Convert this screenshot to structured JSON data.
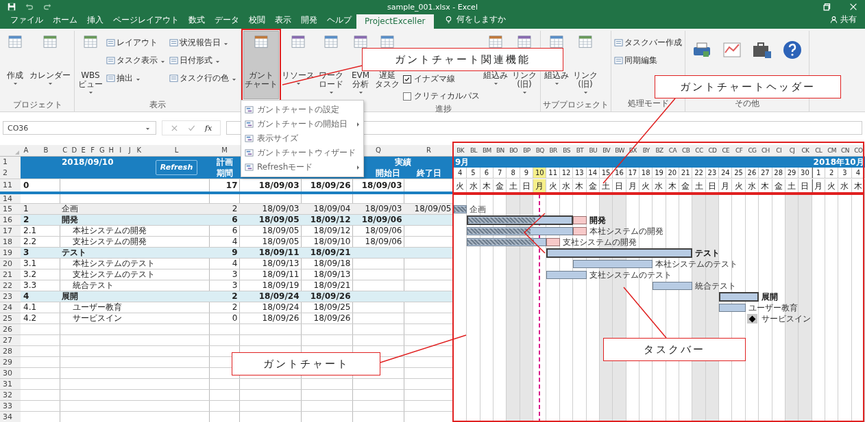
{
  "window": {
    "title": "sample_001.xlsx - Excel"
  },
  "ribbon_tabs": [
    {
      "label": "ファイル",
      "selected": false
    },
    {
      "label": "ホーム",
      "selected": false
    },
    {
      "label": "挿入",
      "selected": false
    },
    {
      "label": "ページレイアウト",
      "selected": false
    },
    {
      "label": "数式",
      "selected": false
    },
    {
      "label": "データ",
      "selected": false
    },
    {
      "label": "校閲",
      "selected": false
    },
    {
      "label": "表示",
      "selected": false
    },
    {
      "label": "開発",
      "selected": false
    },
    {
      "label": "ヘルプ",
      "selected": false
    },
    {
      "label": "ProjectExceller",
      "selected": true
    }
  ],
  "tell_me": "何をしますか",
  "share": "共有",
  "ribbon_groups": [
    {
      "label": "プロジェクト",
      "items": [
        {
          "kind": "large",
          "lines": [
            "作成"
          ],
          "dropdown": true,
          "pressed": false
        },
        {
          "kind": "large",
          "lines": [
            "カレンダー"
          ],
          "dropdown": true,
          "pressed": false
        }
      ]
    },
    {
      "label": "表示",
      "items": [
        {
          "kind": "large",
          "lines": [
            "WBS",
            "ビュー"
          ],
          "dropdown": true,
          "pressed": false
        },
        {
          "kind": "stack",
          "entries": [
            {
              "label": "レイアウト",
              "dropdown": false
            },
            {
              "label": "タスク表示",
              "dropdown": true
            },
            {
              "label": "抽出",
              "dropdown": true
            }
          ]
        },
        {
          "kind": "stack",
          "entries": [
            {
              "label": "状況報告日",
              "dropdown": true
            },
            {
              "label": "日付形式",
              "dropdown": true
            },
            {
              "label": "タスク行の色",
              "dropdown": true
            }
          ]
        }
      ]
    },
    {
      "items": [
        {
          "kind": "large",
          "lines": [
            "ガント",
            "チャート"
          ],
          "dropdown": false,
          "pressed": true
        },
        {
          "kind": "large",
          "lines": [
            "リソース"
          ],
          "dropdown": true,
          "pressed": false
        },
        {
          "kind": "large",
          "lines": [
            "ワーク",
            "ロード"
          ],
          "dropdown": true,
          "pressed": false
        }
      ]
    },
    {
      "label": "進捗",
      "items": [
        {
          "kind": "large",
          "lines": [
            "EVM",
            "分析"
          ],
          "dropdown": true,
          "pressed": false
        },
        {
          "kind": "large",
          "lines": [
            "遅延",
            "タスク"
          ],
          "dropdown": false,
          "pressed": false
        },
        {
          "kind": "checks",
          "entries": [
            {
              "label": "イナズマ線",
              "checked": true
            },
            {
              "label": "クリティカルパス",
              "checked": false
            }
          ]
        },
        {
          "kind": "large",
          "lines": [
            "組込み"
          ],
          "dropdown": true,
          "pressed": false
        },
        {
          "kind": "large",
          "lines": [
            "リンク",
            "(旧)"
          ],
          "dropdown": true,
          "pressed": false
        }
      ]
    },
    {
      "label": "サブプロジェクト",
      "items": [
        {
          "kind": "large",
          "lines": [
            "組込み"
          ],
          "dropdown": true,
          "pressed": false
        },
        {
          "kind": "large",
          "lines": [
            "リンク",
            "(旧)"
          ],
          "dropdown": true,
          "pressed": false
        }
      ]
    },
    {
      "label": "処理モード",
      "items": [
        {
          "kind": "stack",
          "entries": [
            {
              "label": "タスクバー作成",
              "dropdown": false
            },
            {
              "label": "同期編集",
              "dropdown": false
            }
          ]
        }
      ]
    },
    {
      "label": "その他",
      "items": [
        {
          "kind": "icon"
        },
        {
          "kind": "icon"
        },
        {
          "kind": "icon"
        },
        {
          "kind": "icon"
        }
      ]
    }
  ],
  "gantt_menu": [
    {
      "label": "ガントチャートの設定",
      "submenu": false
    },
    {
      "label": "ガントチャートの開始日",
      "submenu": true
    },
    {
      "label": "表示サイズ",
      "submenu": false
    },
    {
      "label": "ガントチャートウィザード",
      "submenu": false
    },
    {
      "label": "Refreshモード",
      "submenu": true
    }
  ],
  "formula_bar": {
    "name_box": "CO36",
    "function_label": "fx"
  },
  "sheet_columns": [
    "A",
    "B",
    "C",
    "D",
    "E",
    "F",
    "G",
    "H",
    "I",
    "J",
    "K",
    "L",
    "M",
    "Q",
    "R"
  ],
  "header": {
    "row_numbers": [
      "1",
      "2"
    ],
    "status_date": "2018/09/10",
    "refresh": "Refresh",
    "plan_top": "計画",
    "plan_bottom": "期間",
    "actual": "実績",
    "actual_start": "開始日",
    "actual_end": "終了日"
  },
  "total_row": {
    "row_number": "11",
    "wbs": "0",
    "duration": "17",
    "plan_start": "18/09/03",
    "plan_end": "18/09/26",
    "actual_start": "18/09/03"
  },
  "spacer_row_number": "14",
  "tasks": [
    {
      "row_number": "15",
      "wbs": "1",
      "name": "企画",
      "kind": "plain",
      "duration": "2",
      "plan_start": "18/09/03",
      "plan_end": "18/09/04",
      "actual_start": "18/09/03",
      "actual_end": "18/09/05",
      "bar_label": "企画",
      "level": 1,
      "delayed": false
    },
    {
      "row_number": "16",
      "wbs": "2",
      "name": "開発",
      "kind": "summary",
      "duration": "6",
      "plan_start": "18/09/05",
      "plan_end": "18/09/12",
      "actual_start": "18/09/06",
      "bar_label": "開発",
      "level": 0.65,
      "delayed": true
    },
    {
      "row_number": "17",
      "wbs": "2.1",
      "name": "本社システムの開発",
      "kind": "task",
      "duration": "6",
      "plan_start": "18/09/05",
      "plan_end": "18/09/12",
      "actual_start": "18/09/06",
      "bar_label": "本社システムの開発",
      "level": 0.6,
      "delayed": true
    },
    {
      "row_number": "18",
      "wbs": "2.2",
      "name": "支社システムの開発",
      "kind": "task",
      "duration": "4",
      "plan_start": "18/09/05",
      "plan_end": "18/09/10",
      "actual_start": "18/09/06",
      "bar_label": "支社システムの開発",
      "level": 0.85,
      "delayed": true
    },
    {
      "row_number": "19",
      "wbs": "3",
      "name": "テスト",
      "kind": "summary",
      "duration": "9",
      "plan_start": "18/09/11",
      "plan_end": "18/09/21",
      "bar_label": "テスト",
      "delayed": false
    },
    {
      "row_number": "20",
      "wbs": "3.1",
      "name": "本社システムのテスト",
      "kind": "task",
      "duration": "4",
      "plan_start": "18/09/13",
      "plan_end": "18/09/18",
      "bar_label": "本社システムのテスト",
      "delayed": false
    },
    {
      "row_number": "21",
      "wbs": "3.2",
      "name": "支社システムのテスト",
      "kind": "task",
      "duration": "3",
      "plan_start": "18/09/11",
      "plan_end": "18/09/13",
      "bar_label": "支社システムのテスト",
      "delayed": false
    },
    {
      "row_number": "22",
      "wbs": "3.3",
      "name": "統合テスト",
      "kind": "task",
      "duration": "3",
      "plan_start": "18/09/19",
      "plan_end": "18/09/21",
      "bar_label": "統合テスト",
      "delayed": false
    },
    {
      "row_number": "23",
      "wbs": "4",
      "name": "展開",
      "kind": "summary",
      "duration": "2",
      "plan_start": "18/09/24",
      "plan_end": "18/09/26",
      "bar_label": "展開",
      "delayed": false
    },
    {
      "row_number": "24",
      "wbs": "4.1",
      "name": "ユーザー教育",
      "kind": "task",
      "duration": "2",
      "plan_start": "18/09/24",
      "plan_end": "18/09/25",
      "bar_label": "ユーザー教育",
      "delayed": false
    },
    {
      "row_number": "25",
      "wbs": "4.2",
      "name": "サービスイン",
      "kind": "milestone",
      "duration": "0",
      "plan_start": "18/09/26",
      "plan_end": "18/09/26",
      "bar_label": "サービスイン",
      "delayed": false
    }
  ],
  "empty_rows": [
    "26",
    "27",
    "28",
    "29",
    "30",
    "31",
    "32",
    "33",
    "34"
  ],
  "gantt": {
    "columns": [
      "BK",
      "BL",
      "BM",
      "BN",
      "BO",
      "BP",
      "BQ",
      "BR",
      "BS",
      "BT",
      "BU",
      "BV",
      "BW",
      "BX",
      "BY",
      "BZ",
      "CA",
      "CB",
      "CC",
      "CD",
      "CE",
      "CF",
      "CG",
      "CH",
      "CI",
      "CJ",
      "CK",
      "CL",
      "CM",
      "CN",
      "CO"
    ],
    "months": [
      "9月",
      "2018年10月"
    ],
    "days": [
      {
        "date": "4",
        "weekday": "火",
        "weekend": false,
        "today": false
      },
      {
        "date": "5",
        "weekday": "水",
        "weekend": false,
        "today": false
      },
      {
        "date": "6",
        "weekday": "木",
        "weekend": false,
        "today": false
      },
      {
        "date": "7",
        "weekday": "金",
        "weekend": false,
        "today": false
      },
      {
        "date": "8",
        "weekday": "土",
        "weekend": true,
        "today": false
      },
      {
        "date": "9",
        "weekday": "日",
        "weekend": true,
        "today": false
      },
      {
        "date": "10",
        "weekday": "月",
        "weekend": false,
        "today": true
      },
      {
        "date": "11",
        "weekday": "火",
        "weekend": false,
        "today": false
      },
      {
        "date": "12",
        "weekday": "水",
        "weekend": false,
        "today": false
      },
      {
        "date": "13",
        "weekday": "木",
        "weekend": false,
        "today": false
      },
      {
        "date": "14",
        "weekday": "金",
        "weekend": false,
        "today": false
      },
      {
        "date": "15",
        "weekday": "土",
        "weekend": true,
        "today": false
      },
      {
        "date": "16",
        "weekday": "日",
        "weekend": true,
        "today": false
      },
      {
        "date": "17",
        "weekday": "月",
        "weekend": false,
        "today": false
      },
      {
        "date": "18",
        "weekday": "火",
        "weekend": false,
        "today": false
      },
      {
        "date": "19",
        "weekday": "水",
        "weekend": false,
        "today": false
      },
      {
        "date": "20",
        "weekday": "木",
        "weekend": false,
        "today": false
      },
      {
        "date": "21",
        "weekday": "金",
        "weekend": false,
        "today": false
      },
      {
        "date": "22",
        "weekday": "土",
        "weekend": true,
        "today": false
      },
      {
        "date": "23",
        "weekday": "日",
        "weekend": true,
        "today": false
      },
      {
        "date": "24",
        "weekday": "月",
        "weekend": false,
        "today": false
      },
      {
        "date": "25",
        "weekday": "火",
        "weekend": false,
        "today": false
      },
      {
        "date": "26",
        "weekday": "水",
        "weekend": false,
        "today": false
      },
      {
        "date": "27",
        "weekday": "木",
        "weekend": false,
        "today": false
      },
      {
        "date": "28",
        "weekday": "金",
        "weekend": false,
        "today": false
      },
      {
        "date": "29",
        "weekday": "土",
        "weekend": true,
        "today": false
      },
      {
        "date": "30",
        "weekday": "日",
        "weekend": true,
        "today": false
      },
      {
        "date": "1",
        "weekday": "月",
        "weekend": false,
        "today": false
      },
      {
        "date": "2",
        "weekday": "火",
        "weekend": false,
        "today": false
      },
      {
        "date": "3",
        "weekday": "水",
        "weekend": false,
        "today": false
      },
      {
        "date": "4",
        "weekday": "木",
        "weekend": false,
        "today": false
      }
    ]
  },
  "annotations": [
    "ガントチャート関連機能",
    "ガントチャートヘッダー",
    "ガントチャート",
    "タスクバー"
  ]
}
